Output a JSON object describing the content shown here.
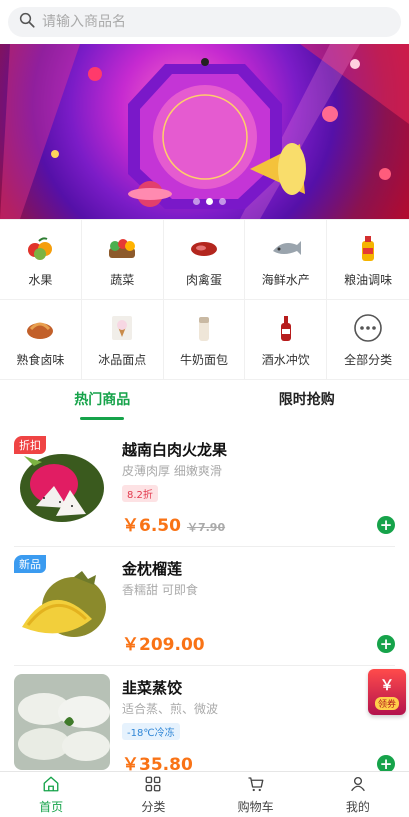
{
  "search": {
    "placeholder": "请输入商品名"
  },
  "banner": {
    "slide_count": 3,
    "active_slide": 2
  },
  "categories": [
    {
      "label": "水果",
      "icon": "fruit-icon"
    },
    {
      "label": "蔬菜",
      "icon": "vegetable-icon"
    },
    {
      "label": "肉禽蛋",
      "icon": "meat-icon"
    },
    {
      "label": "海鲜水产",
      "icon": "seafood-icon"
    },
    {
      "label": "粮油调味",
      "icon": "oil-icon"
    },
    {
      "label": "熟食卤味",
      "icon": "deli-icon"
    },
    {
      "label": "冰品面点",
      "icon": "icecream-icon"
    },
    {
      "label": "牛奶面包",
      "icon": "bread-icon"
    },
    {
      "label": "酒水冲饮",
      "icon": "drink-icon"
    },
    {
      "label": "全部分类",
      "icon": "more-icon"
    }
  ],
  "tabs": [
    {
      "label": "热门商品",
      "active": true
    },
    {
      "label": "限时抢购",
      "active": false
    }
  ],
  "products": [
    {
      "name": "越南白肉火龙果",
      "desc": "皮薄肉厚 细嫩爽滑",
      "badge": "8.2折",
      "tag": "折扣",
      "price": "￥6.50",
      "old_price": "￥7.90"
    },
    {
      "name": "金枕榴莲",
      "desc": "香糯甜 可即食",
      "badge": "",
      "tag": "新品",
      "price": "￥209.00",
      "old_price": ""
    },
    {
      "name": "韭菜蒸饺",
      "desc": "适合蒸、煎、微波",
      "badge": "-18℃冷冻",
      "tag": "",
      "price": "￥35.80",
      "old_price": ""
    }
  ],
  "coupon": {
    "symbol": "￥",
    "label": "领券"
  },
  "nav": [
    {
      "label": "首页",
      "icon": "home-icon",
      "active": true
    },
    {
      "label": "分类",
      "icon": "grid-icon",
      "active": false
    },
    {
      "label": "购物车",
      "icon": "cart-icon",
      "active": false
    },
    {
      "label": "我的",
      "icon": "user-icon",
      "active": false
    }
  ],
  "colors": {
    "accent": "#16a34a",
    "price": "#f97316",
    "discount_tag": "#ef4444",
    "new_tag": "#3b9bf0"
  }
}
